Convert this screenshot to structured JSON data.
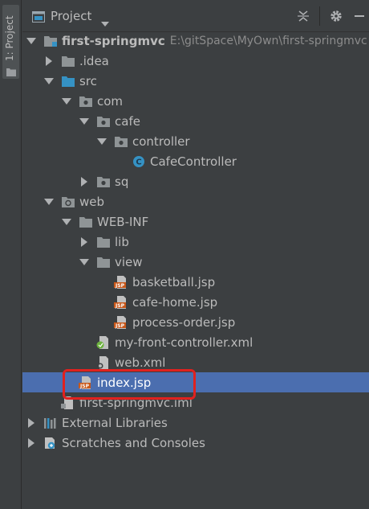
{
  "stripe": {
    "tab_label": "1: Project"
  },
  "header": {
    "title": "Project"
  },
  "tree": [
    {
      "label": "first-springmvc",
      "path": "E:\\gitSpace\\MyOwn\\first-springmvc",
      "indent": 0,
      "arrow": "down",
      "icon": "module-folder-icon"
    },
    {
      "label": ".idea",
      "indent": 1,
      "arrow": "right",
      "icon": "folder-icon"
    },
    {
      "label": "src",
      "indent": 1,
      "arrow": "down",
      "icon": "source-folder-icon"
    },
    {
      "label": "com",
      "indent": 2,
      "arrow": "down",
      "icon": "package-icon"
    },
    {
      "label": "cafe",
      "indent": 3,
      "arrow": "down",
      "icon": "package-icon"
    },
    {
      "label": "controller",
      "indent": 4,
      "arrow": "down",
      "icon": "package-icon"
    },
    {
      "label": "CafeController",
      "indent": 5,
      "arrow": "none",
      "icon": "java-class-icon"
    },
    {
      "label": "sq",
      "indent": 3,
      "arrow": "right",
      "icon": "package-icon"
    },
    {
      "label": "web",
      "indent": 1,
      "arrow": "down",
      "icon": "web-folder-icon"
    },
    {
      "label": "WEB-INF",
      "indent": 2,
      "arrow": "down",
      "icon": "folder-icon"
    },
    {
      "label": "lib",
      "indent": 3,
      "arrow": "right",
      "icon": "folder-icon"
    },
    {
      "label": "view",
      "indent": 3,
      "arrow": "down",
      "icon": "folder-icon"
    },
    {
      "label": "basketball.jsp",
      "indent": 4,
      "arrow": "none",
      "icon": "jsp-file-icon"
    },
    {
      "label": "cafe-home.jsp",
      "indent": 4,
      "arrow": "none",
      "icon": "jsp-file-icon"
    },
    {
      "label": "process-order.jsp",
      "indent": 4,
      "arrow": "none",
      "icon": "jsp-file-icon"
    },
    {
      "label": "my-front-controller.xml",
      "indent": 3,
      "arrow": "none",
      "icon": "spring-xml-icon"
    },
    {
      "label": "web.xml",
      "indent": 3,
      "arrow": "none",
      "icon": "xml-file-icon"
    },
    {
      "label": "index.jsp",
      "indent": 2,
      "arrow": "none",
      "icon": "jsp-file-icon",
      "selected": true
    },
    {
      "label": "first-springmvc.iml",
      "indent": 1,
      "arrow": "none",
      "icon": "iml-file-icon"
    },
    {
      "label": "External Libraries",
      "indent": 0,
      "arrow": "right",
      "icon": "libraries-icon"
    },
    {
      "label": "Scratches and Consoles",
      "indent": 0,
      "arrow": "right",
      "icon": "scratches-icon"
    }
  ],
  "colors": {
    "background": "#3c3f41",
    "selection": "#4b6eaf",
    "highlight_box": "#e0211f",
    "folder": "#8f9496",
    "source_folder": "#3592c4"
  }
}
